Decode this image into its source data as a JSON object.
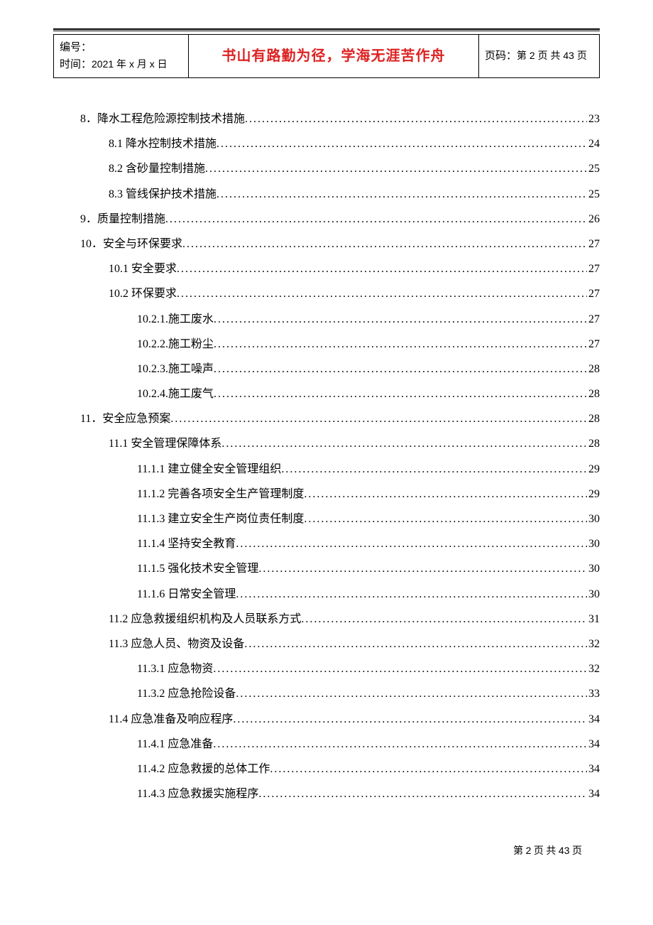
{
  "header": {
    "serial_label": "编号：",
    "time_label": "时间：",
    "time_value": "2021 年 x 月 x 日",
    "motto": "书山有路勤为径，学海无涯苦作舟",
    "page_label_prefix": "页码：",
    "page_label": "第 2 页  共 43 页"
  },
  "toc": [
    {
      "indent": 1,
      "label": "8．降水工程危险源控制技术措施",
      "page": "23"
    },
    {
      "indent": 2,
      "label": "8.1 降水控制技术措施",
      "page": "24"
    },
    {
      "indent": 2,
      "label": "8.2 含砂量控制措施",
      "page": "25"
    },
    {
      "indent": 2,
      "label": "8.3 管线保护技术措施",
      "page": "25"
    },
    {
      "indent": 1,
      "label": "9．质量控制措施",
      "page": "26"
    },
    {
      "indent": 1,
      "label": "10．安全与环保要求",
      "page": "27"
    },
    {
      "indent": 2,
      "label": "10.1 安全要求",
      "page": "27"
    },
    {
      "indent": 2,
      "label": "10.2 环保要求",
      "page": "27"
    },
    {
      "indent": 3,
      "label": "10.2.1.施工废水",
      "page": "27"
    },
    {
      "indent": 3,
      "label": "10.2.2.施工粉尘",
      "page": "27"
    },
    {
      "indent": 3,
      "label": "10.2.3.施工噪声",
      "page": "28"
    },
    {
      "indent": 3,
      "label": "10.2.4.施工废气",
      "page": "28"
    },
    {
      "indent": 1,
      "label": "11．安全应急预案",
      "page": "28"
    },
    {
      "indent": 2,
      "label": "11.1 安全管理保障体系",
      "page": "28"
    },
    {
      "indent": 3,
      "label": "11.1.1 建立健全安全管理组织 ",
      "page": "29"
    },
    {
      "indent": 3,
      "label": "11.1.2 完善各项安全生产管理制度 ",
      "page": "29"
    },
    {
      "indent": 3,
      "label": "11.1.3 建立安全生产岗位责任制度 ",
      "page": "30"
    },
    {
      "indent": 3,
      "label": "11.1.4 坚持安全教育 ",
      "page": "30"
    },
    {
      "indent": 3,
      "label": "11.1.5 强化技术安全管理 ",
      "page": "30"
    },
    {
      "indent": 3,
      "label": "11.1.6 日常安全管理 ",
      "page": "30"
    },
    {
      "indent": 2,
      "label": "11.2 应急救援组织机构及人员联系方式",
      "page": "31"
    },
    {
      "indent": 2,
      "label": "11.3 应急人员、物资及设备",
      "page": "32"
    },
    {
      "indent": 3,
      "label": "11.3.1 应急物资 ",
      "page": "32"
    },
    {
      "indent": 3,
      "label": "11.3.2 应急抢险设备 ",
      "page": "33"
    },
    {
      "indent": 2,
      "label": "11.4 应急准备及响应程序",
      "page": "34"
    },
    {
      "indent": 3,
      "label": "11.4.1 应急准备 ",
      "page": "34"
    },
    {
      "indent": 3,
      "label": "11.4.2 应急救援的总体工作 ",
      "page": "34"
    },
    {
      "indent": 3,
      "label": "11.4.3 应急救援实施程序 ",
      "page": "34"
    }
  ],
  "footer": {
    "text_prefix": "第 ",
    "current": "2",
    "text_mid": " 页 共 ",
    "total": "43",
    "text_suffix": " 页"
  }
}
